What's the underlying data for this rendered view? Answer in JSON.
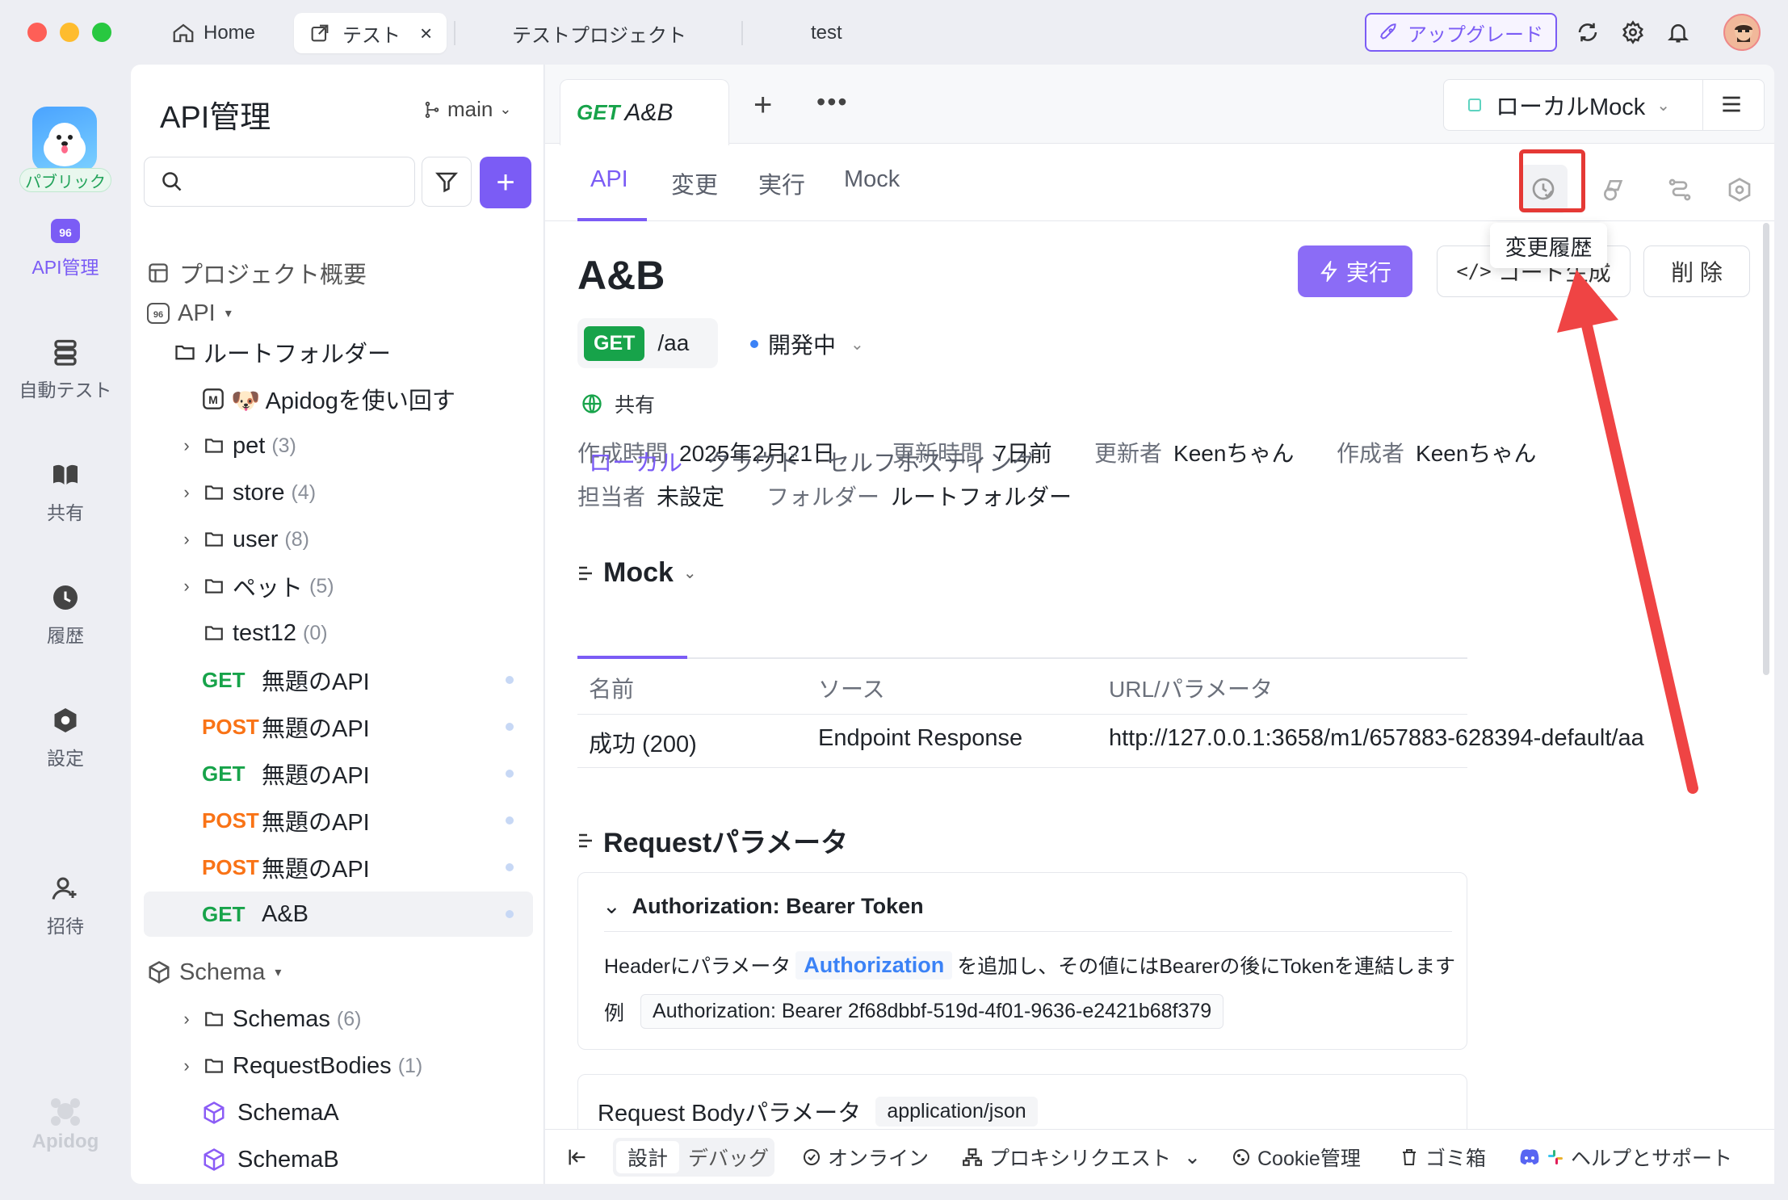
{
  "window": {
    "tabs": [
      {
        "label": "Home"
      },
      {
        "label": "テスト"
      },
      {
        "label": "テストプロジェクト"
      },
      {
        "label": "test"
      }
    ],
    "upgrade_label": "アップグレード"
  },
  "rail": {
    "public_badge": "パブリック",
    "items": [
      {
        "label": "API管理"
      },
      {
        "label": "自動テスト"
      },
      {
        "label": "共有"
      },
      {
        "label": "履歴"
      },
      {
        "label": "設定"
      },
      {
        "label": "招待"
      }
    ],
    "footer_logo": "Apidog"
  },
  "side": {
    "title": "API管理",
    "branch": "main",
    "search_placeholder": "",
    "project_overview": "プロジェクト概要",
    "api_group": "API",
    "root_folder": "ルートフォルダー",
    "tree": [
      {
        "label": "🐶 Apidogを使い回す"
      },
      {
        "label": "pet",
        "count": "(3)"
      },
      {
        "label": "store",
        "count": "(4)"
      },
      {
        "label": "user",
        "count": "(8)"
      },
      {
        "label": "ペット",
        "count": "(5)"
      },
      {
        "label": "test12",
        "count": "(0)"
      }
    ],
    "endpoints": [
      {
        "method": "GET",
        "name": "無題のAPI"
      },
      {
        "method": "POST",
        "name": "無題のAPI"
      },
      {
        "method": "GET",
        "name": "無題のAPI"
      },
      {
        "method": "POST",
        "name": "無題のAPI"
      },
      {
        "method": "POST",
        "name": "無題のAPI"
      },
      {
        "method": "GET",
        "name": "A&B"
      }
    ],
    "schema_group": "Schema",
    "schema_items": [
      {
        "label": "Schemas",
        "count": "(6)"
      },
      {
        "label": "RequestBodies",
        "count": "(1)"
      },
      {
        "label": "SchemaA"
      },
      {
        "label": "SchemaB"
      }
    ]
  },
  "main": {
    "doc_tab": {
      "method": "GET",
      "name": "A&B"
    },
    "env": "ローカルMock",
    "sub_tabs": [
      "API",
      "変更",
      "実行",
      "Mock"
    ],
    "tooltip": "変更履歴",
    "title": "A&B",
    "method": "GET",
    "path": "/aa",
    "status": "開発中",
    "shared": "共有",
    "buttons": {
      "run": "実行",
      "code": "コード生成",
      "delete": "削 除"
    },
    "meta": {
      "created_label": "作成時間",
      "created": "2025年2月21日",
      "updated_label": "更新時間",
      "updated": "7日前",
      "updater_label": "更新者",
      "updater": "Keenちゃん",
      "creator_label": "作成者",
      "creator": "Keenちゃん",
      "assignee_label": "担当者",
      "assignee": "未設定",
      "folder_label": "フォルダー",
      "folder": "ルートフォルダー"
    },
    "mock": {
      "title": "Mock",
      "tabs": [
        "ローカル",
        "クラウド",
        "セルフホスティング"
      ],
      "columns": [
        "名前",
        "ソース",
        "URL/パラメータ"
      ],
      "rows": [
        {
          "name": "成功 (200)",
          "source": "Endpoint Response",
          "url": "http://127.0.0.1:3658/m1/657883-628394-default/aa"
        }
      ]
    },
    "request": {
      "title": "Requestパラメータ",
      "auth_title": "Authorization: Bearer Token",
      "desc_pre": "Headerにパラメータ",
      "desc_key": "Authorization",
      "desc_post": "を追加し、その値にはBearerの後にTokenを連結します",
      "example_label": "例",
      "example": "Authorization: Bearer 2f68dbbf-519d-4f01-9636-e2421b68f379",
      "body_title": "Request Bodyパラメータ",
      "body_type": "application/json"
    }
  },
  "bottom": {
    "design": "設計",
    "debug": "デバッグ",
    "online": "オンライン",
    "proxy": "プロキシリクエスト",
    "cookie": "Cookie管理",
    "trash": "ゴミ箱",
    "help": "ヘルプとサポート"
  },
  "colors": {
    "accent": "#7b5cf5",
    "get": "#17a34a",
    "post": "#f97316",
    "annotation": "#e53935"
  }
}
